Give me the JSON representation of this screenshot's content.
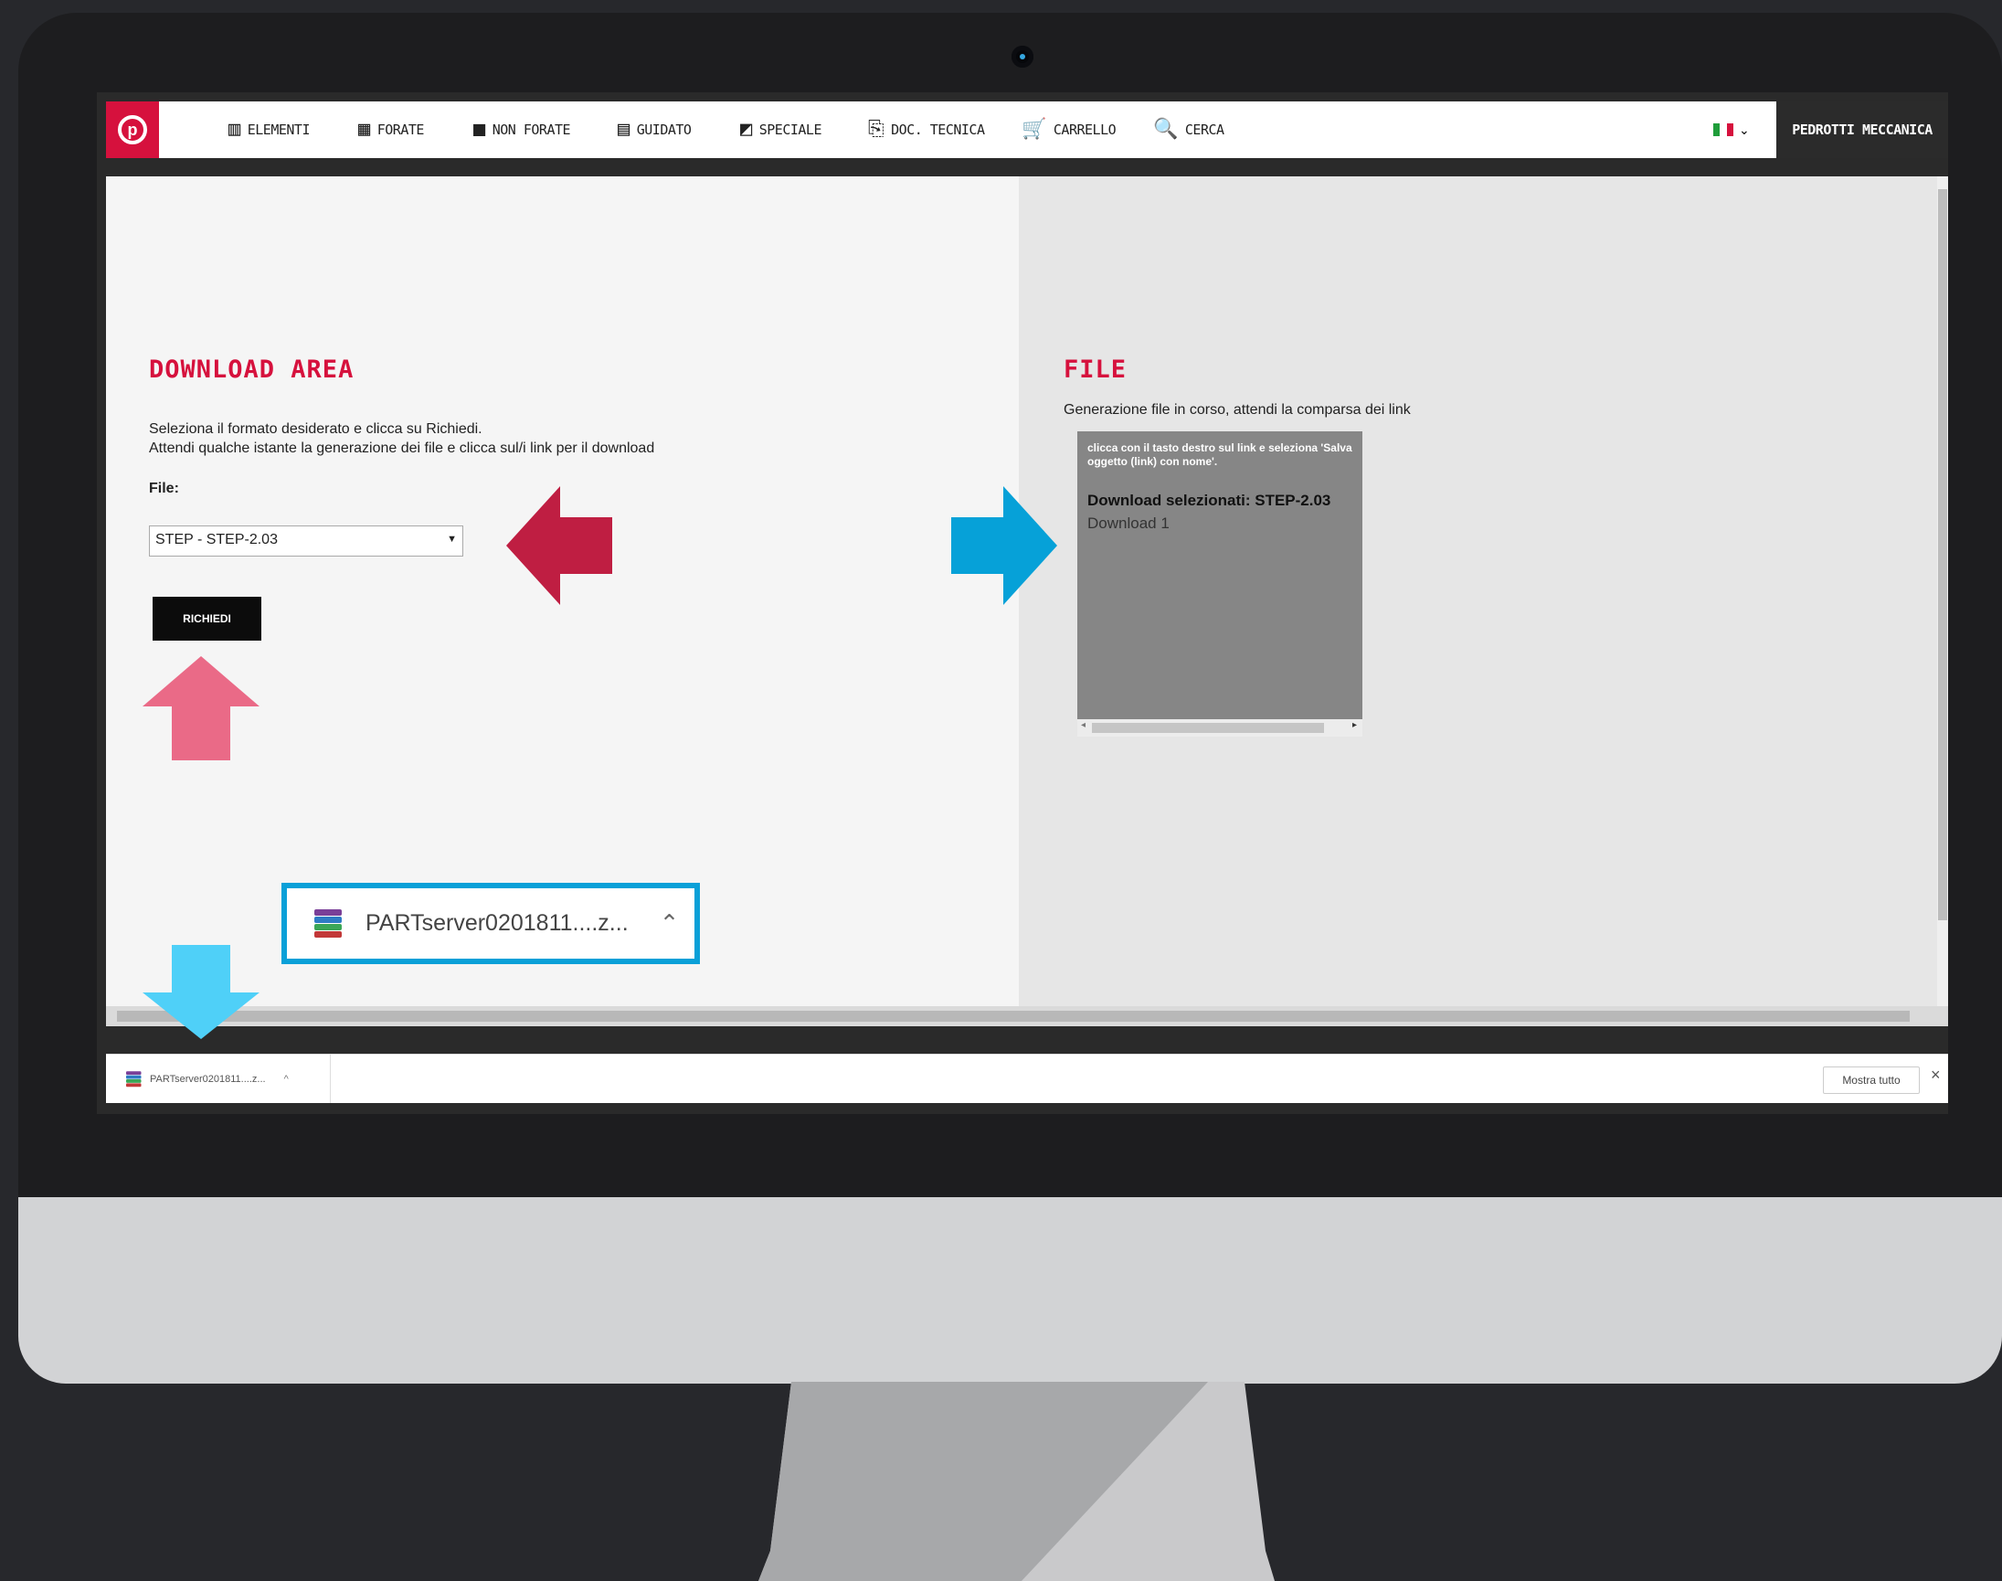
{
  "header": {
    "logo_letter": "p",
    "nav": [
      {
        "label": "Elementi",
        "icon": "elements-icon",
        "glyph": "▥"
      },
      {
        "label": "Forate",
        "icon": "perforated-icon",
        "glyph": "▦"
      },
      {
        "label": "Non forate",
        "icon": "solid-block-icon",
        "glyph": "■"
      },
      {
        "label": "Guidato",
        "icon": "guided-icon",
        "glyph": "▤"
      },
      {
        "label": "Speciale",
        "icon": "special-icon",
        "glyph": "◩"
      },
      {
        "label": "Doc. tecnica",
        "icon": "tech-doc-icon",
        "glyph": "⎘"
      },
      {
        "label": "Carrello",
        "icon": "cart-icon",
        "glyph": "🛒"
      },
      {
        "label": "Cerca",
        "icon": "search-icon",
        "glyph": "🔍"
      }
    ],
    "language_chevron": "⌄",
    "company": "PEDROTTI MECCANICA"
  },
  "download_area": {
    "title": "DOWNLOAD AREA",
    "instruction_1": "Seleziona il formato desiderato e clicca su Richiedi.",
    "instruction_2": "Attendi qualche istante la generazione dei file e clicca sul/i link per il download",
    "file_label": "File:",
    "file_selected": "STEP - STEP-2.03",
    "request_button": "RICHIEDI"
  },
  "file_panel": {
    "title": "FILE",
    "status": "Generazione file in corso, attendi la comparsa dei link",
    "hint": "clicca con il tasto destro sul link e seleziona 'Salva oggetto (link) con nome'.",
    "selected_label": "Download selezionati: STEP-2.03",
    "link": "Download 1"
  },
  "download_bar": {
    "filename": "PARTserver0201811....z...",
    "show_all": "Mostra tutto",
    "close": "×"
  },
  "callout": {
    "filename": "PARTserver0201811....z..."
  },
  "colors": {
    "brand_red": "#d6113d",
    "arrow_red": "#bf1e42",
    "arrow_pink": "#ea6a87",
    "arrow_blue": "#06a1d8",
    "arrow_light_blue": "#4fd0f8",
    "callout_border": "#0aa0d8"
  }
}
